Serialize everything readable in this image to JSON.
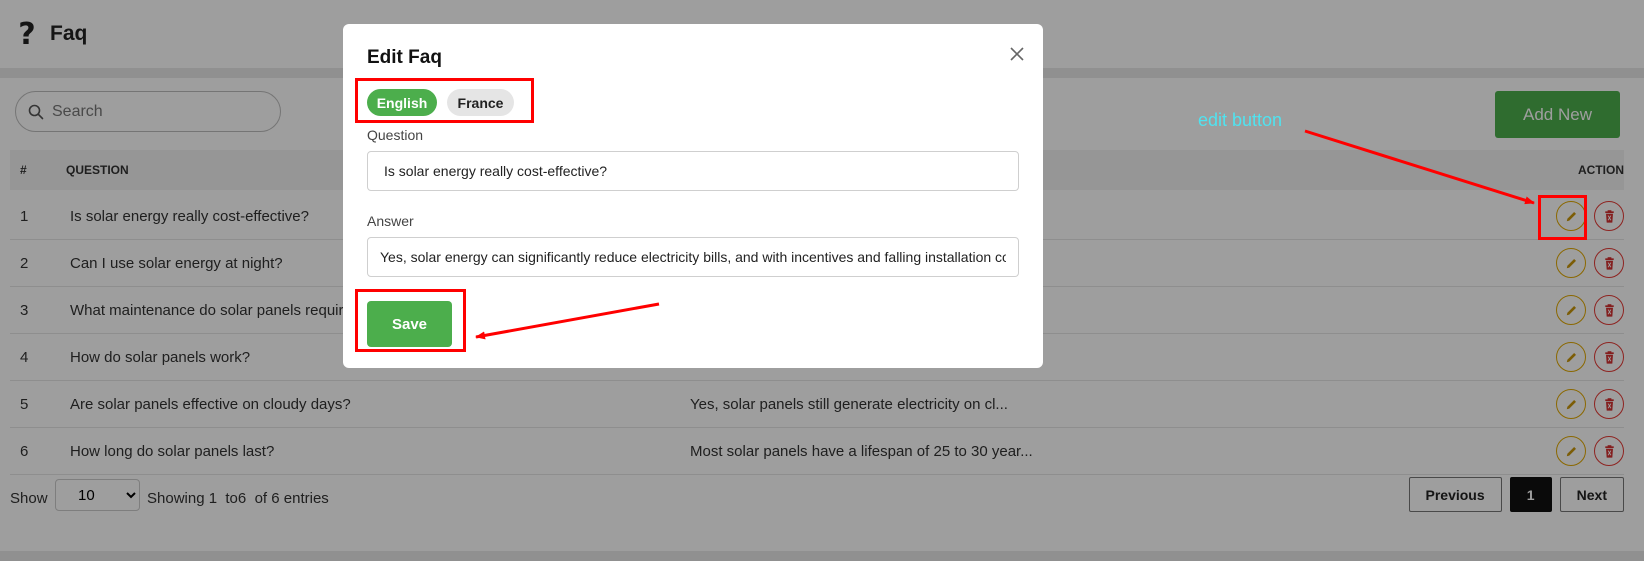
{
  "header": {
    "title": "Faq",
    "icon": "question-mark-icon"
  },
  "search": {
    "placeholder": "Search"
  },
  "toolbar": {
    "add_new_label": "Add New"
  },
  "table": {
    "columns": {
      "num": "#",
      "question": "QUESTION",
      "action": "ACTION"
    },
    "rows": [
      {
        "num": "1",
        "question": "Is solar energy really cost-effective?",
        "answer": ""
      },
      {
        "num": "2",
        "question": "Can I use solar energy at night?",
        "answer": ""
      },
      {
        "num": "3",
        "question": "What maintenance do solar panels require?",
        "answer": ""
      },
      {
        "num": "4",
        "question": "How do solar panels work?",
        "answer": ""
      },
      {
        "num": "5",
        "question": "Are solar panels effective on cloudy days?",
        "answer": "Yes, solar panels still generate electricity on cl..."
      },
      {
        "num": "6",
        "question": "How long do solar panels last?",
        "answer": "Most solar panels have a lifespan of 25 to 30 year..."
      }
    ]
  },
  "footer": {
    "show_label": "Show",
    "page_size": "10",
    "info": "Showing 1  to6  of 6 entries",
    "prev_label": "Previous",
    "current_page": "1",
    "next_label": "Next"
  },
  "modal": {
    "title": "Edit Faq",
    "lang_english": "English",
    "lang_france": "France",
    "question_label": "Question",
    "question_value": "Is solar energy really cost-effective?",
    "answer_label": "Answer",
    "answer_value": "Yes, solar energy can significantly reduce electricity bills, and with incentives and falling installation costs",
    "save_label": "Save"
  },
  "annotation": {
    "edit_text": "edit button"
  },
  "colors": {
    "accent_green": "#4cae4c",
    "edit_yellow": "#e0a800",
    "delete_red": "#e53935",
    "annotation_red": "#ff0000",
    "annotation_cyan": "#4fe3f0"
  }
}
